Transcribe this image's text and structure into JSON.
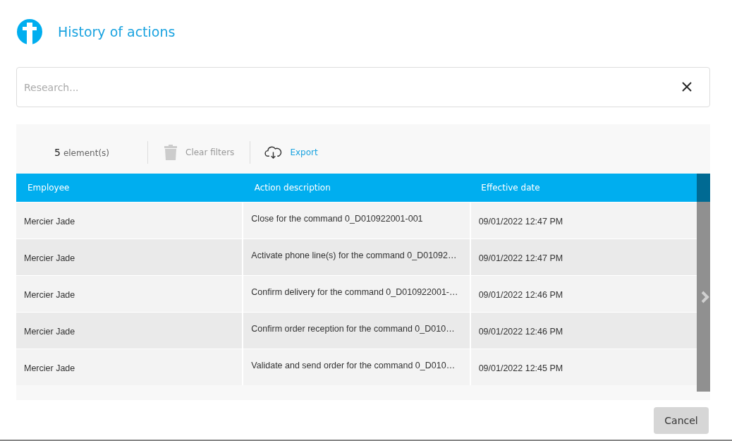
{
  "dialog": {
    "title": "History of actions"
  },
  "search": {
    "placeholder": "Research..."
  },
  "toolbar": {
    "count": "5",
    "count_label": "element(s)",
    "clear_filters": {
      "label": "Clear filters",
      "disabled": true
    },
    "export": {
      "label": "Export",
      "disabled": false
    }
  },
  "table": {
    "columns": [
      "Employee",
      "Action description",
      "Effective date"
    ],
    "rows": [
      {
        "cells": [
          "Mercier Jade",
          "Close for the command 0_D010922001-001",
          "09/01/2022 12:47 PM"
        ]
      },
      {
        "cells": [
          "Mercier Jade",
          "Activate phone line(s) for the command 0_D01092…",
          "09/01/2022 12:47 PM"
        ]
      },
      {
        "cells": [
          "Mercier Jade",
          "Confirm delivery for the command 0_D010922001-…",
          "09/01/2022 12:46 PM"
        ]
      },
      {
        "cells": [
          "Mercier Jade",
          "Confirm order reception for the command 0_D010…",
          "09/01/2022 12:46 PM"
        ]
      },
      {
        "cells": [
          "Mercier Jade",
          "Validate and send order for the command 0_D010…",
          "09/01/2022 12:45 PM"
        ]
      }
    ]
  },
  "buttons": [
    {
      "label": "Cancel"
    }
  ]
}
